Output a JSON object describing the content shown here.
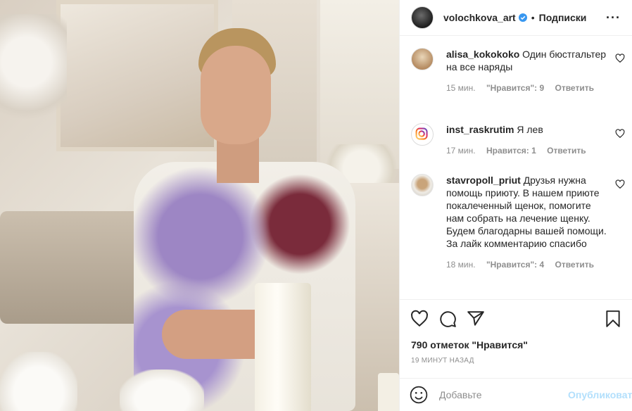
{
  "header": {
    "username": "volochkova_art",
    "separator": "•",
    "follow_label": "Подписки",
    "more_label": "···"
  },
  "comments": [
    {
      "username": "alisa_kokokoko",
      "text": "Один бюстгальтер на все наряды",
      "time": "15 мин.",
      "likes": "\"Нравится\": 9",
      "reply": "Ответить"
    },
    {
      "username": "inst_raskrutim",
      "text": "Я лев",
      "time": "17 мин.",
      "likes": "Нравится: 1",
      "reply": "Ответить"
    },
    {
      "username": "stavropoll_priut",
      "text": "Друзья нужна помощь приюту. В нашем приюте покалеченный щенок, помогите нам собрать на лечение щенку. Будем благодарны вашей помощи. За лайк комментарию спасибо",
      "time": "18 мин.",
      "likes": "\"Нравится\": 4",
      "reply": "Ответить"
    }
  ],
  "post": {
    "likes_text": "790 отметок \"Нравится\"",
    "time_text": "19 МИНУТ НАЗАД"
  },
  "add_comment": {
    "placeholder": "Добавьте",
    "publish_label": "Опубликовать"
  },
  "colors": {
    "verified": "#3897f0",
    "publish_disabled": "#b2dffc",
    "meta_gray": "#8e8e8e"
  }
}
